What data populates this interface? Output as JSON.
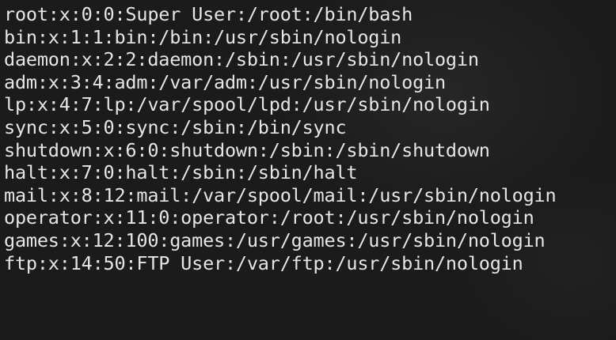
{
  "terminal": {
    "lines": [
      "root:x:0:0:Super User:/root:/bin/bash",
      "bin:x:1:1:bin:/bin:/usr/sbin/nologin",
      "daemon:x:2:2:daemon:/sbin:/usr/sbin/nologin",
      "adm:x:3:4:adm:/var/adm:/usr/sbin/nologin",
      "lp:x:4:7:lp:/var/spool/lpd:/usr/sbin/nologin",
      "sync:x:5:0:sync:/sbin:/bin/sync",
      "shutdown:x:6:0:shutdown:/sbin:/sbin/shutdown",
      "halt:x:7:0:halt:/sbin:/sbin/halt",
      "mail:x:8:12:mail:/var/spool/mail:/usr/sbin/nologin",
      "operator:x:11:0:operator:/root:/usr/sbin/nologin",
      "games:x:12:100:games:/usr/games:/usr/sbin/nologin",
      "ftp:x:14:50:FTP User:/var/ftp:/usr/sbin/nologin"
    ]
  }
}
